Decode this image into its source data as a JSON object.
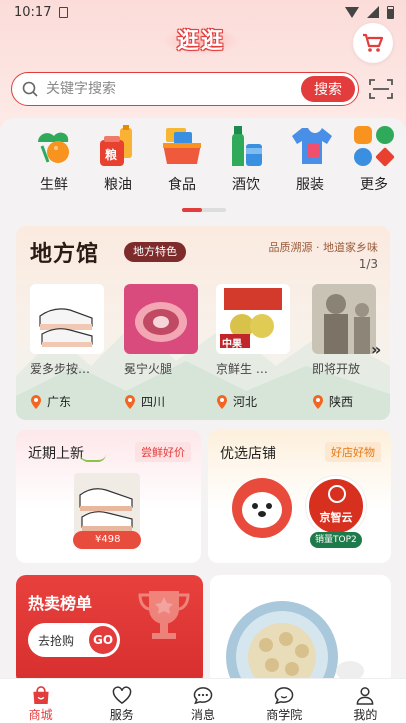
{
  "status_bar": {
    "time": "10:17"
  },
  "header": {
    "logo_text": "逛逛"
  },
  "search": {
    "placeholder": "关键字搜索",
    "button_label": "搜索"
  },
  "categories": [
    {
      "label": "生鲜",
      "icon": "fresh-produce-icon"
    },
    {
      "label": "粮油",
      "icon": "grain-oil-icon",
      "icon_text": "粮"
    },
    {
      "label": "食品",
      "icon": "food-icon"
    },
    {
      "label": "酒饮",
      "icon": "drinks-icon"
    },
    {
      "label": "服装",
      "icon": "clothing-icon"
    },
    {
      "label": "更多",
      "icon": "more-grid-icon"
    }
  ],
  "difangguan": {
    "title": "地方馆",
    "tag": "地方特色",
    "slogan": "品质溯源 · 地道家乡味",
    "page_indicator": "1/3",
    "products": [
      {
        "name": "爱多步按…",
        "location": "广东"
      },
      {
        "name": "冕宁火腿",
        "location": "四川"
      },
      {
        "name": "京鲜生 …",
        "location": "河北",
        "image_label": "中果"
      },
      {
        "name": "即将开放",
        "location": "陕西"
      }
    ]
  },
  "cards": {
    "new_arrivals": {
      "title": "近期上新",
      "badge": "尝鲜好价",
      "price": "¥498"
    },
    "preferred_shops": {
      "title": "优选店铺",
      "badge": "好店好物",
      "shop_logo_text": "京智云",
      "shop_rank": "销量TOP2"
    },
    "hot_list": {
      "title": "热卖榜单",
      "cta": "去抢购",
      "go": "GO"
    }
  },
  "tabbar": [
    {
      "label": "商城",
      "icon": "shopping-bag-icon",
      "active": true
    },
    {
      "label": "服务",
      "icon": "heart-icon",
      "active": false
    },
    {
      "label": "消息",
      "icon": "chat-bubble-icon",
      "active": false
    },
    {
      "label": "商学院",
      "icon": "academy-icon",
      "active": false
    },
    {
      "label": "我的",
      "icon": "user-icon",
      "active": false
    }
  ],
  "colors": {
    "accent": "#e23c3c",
    "background": "#f4f2f2"
  }
}
